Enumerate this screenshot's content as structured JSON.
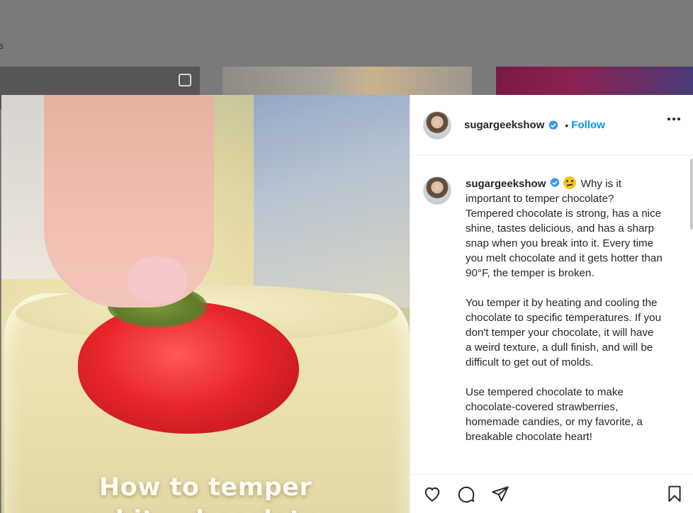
{
  "background": {
    "partial_text": "s"
  },
  "post": {
    "username": "sugargeekshow",
    "separator": "•",
    "follow_label": "Follow",
    "media_overlay": {
      "line1": "How to temper",
      "line2": "white chocolate"
    }
  },
  "caption": {
    "username": "sugargeekshow",
    "intro": "Why is it important to temper chocolate? Tempered chocolate is strong, has a nice shine, tastes delicious, and has a sharp snap when you break into it. Every time you melt chocolate and it gets hotter than 90°F, the temper is broken.",
    "para2": "You temper it by heating and cooling the chocolate to specific temperatures. If you don't temper your chocolate, it will have a weird texture, a dull finish, and will be difficult to get out of molds.",
    "para3": "Use tempered chocolate to make chocolate-covered strawberries, homemade candies, or my favorite, a breakable chocolate heart!"
  },
  "colors": {
    "accent": "#0095f6",
    "text": "#262626",
    "border": "#efefef"
  },
  "icons": [
    "verified-badge-icon",
    "more-options-icon",
    "heart-icon",
    "comment-icon",
    "share-icon",
    "bookmark-icon",
    "thinking-face-emoji"
  ]
}
